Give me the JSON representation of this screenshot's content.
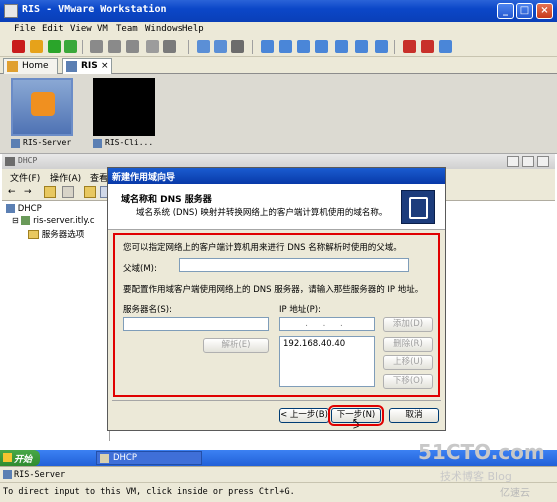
{
  "vmware": {
    "title": "RIS - VMware Workstation",
    "menu": [
      "File",
      "Edit",
      "View",
      "VM",
      "Team",
      "Windows",
      "Help"
    ],
    "tabs": [
      {
        "label": "Home"
      },
      {
        "label": "RIS"
      }
    ],
    "thumbnails": [
      {
        "label": "RIS-Server"
      },
      {
        "label": "RIS-Cli..."
      }
    ],
    "vm_label": "RIS-Server",
    "status_text": "To direct input to this VM, click inside or press Ctrl+G."
  },
  "dhcp": {
    "title": "DHCP",
    "menu": [
      "文件(F)",
      "操作(A)",
      "查看"
    ],
    "tree": [
      "DHCP",
      "ris-server.itly.c",
      "服务器选项"
    ]
  },
  "wizard": {
    "title": "新建作用域向导",
    "heading": "域名称和 DNS 服务器",
    "subheading": "域名系统 (DNS) 映射并转换网络上的客户端计算机使用的域名称。",
    "intro": "您可以指定网络上的客户端计算机用来进行 DNS 名称解析时使用的父域。",
    "parent_domain_label": "父域(M):",
    "parent_domain_value": "",
    "dns_instructions": "要配置作用域客户端使用网络上的 DNS 服务器，请输入那些服务器的 IP 地址。",
    "server_name_label": "服务器名(S):",
    "server_name_value": "",
    "ip_label": "IP 地址(P):",
    "ip_value": ". . .",
    "resolve_button": "解析(E)",
    "add_button": "添加(D)",
    "remove_button": "删除(R)",
    "up_button": "上移(U)",
    "down_button": "下移(O)",
    "dns_list": [
      "192.168.40.40"
    ],
    "back_button": "< 上一步(B)",
    "next_button": "下一步(N) >",
    "cancel_button": "取消"
  },
  "taskbar": {
    "start_label": "开始",
    "items": [
      {
        "label": "DHCP"
      }
    ]
  },
  "watermark": {
    "line1": "51CTO.com",
    "line2": "技术博客 Blog",
    "line3": "亿速云"
  },
  "colors": {
    "highlight_border": "#e00000",
    "xp_blue": "#0b47c8"
  }
}
